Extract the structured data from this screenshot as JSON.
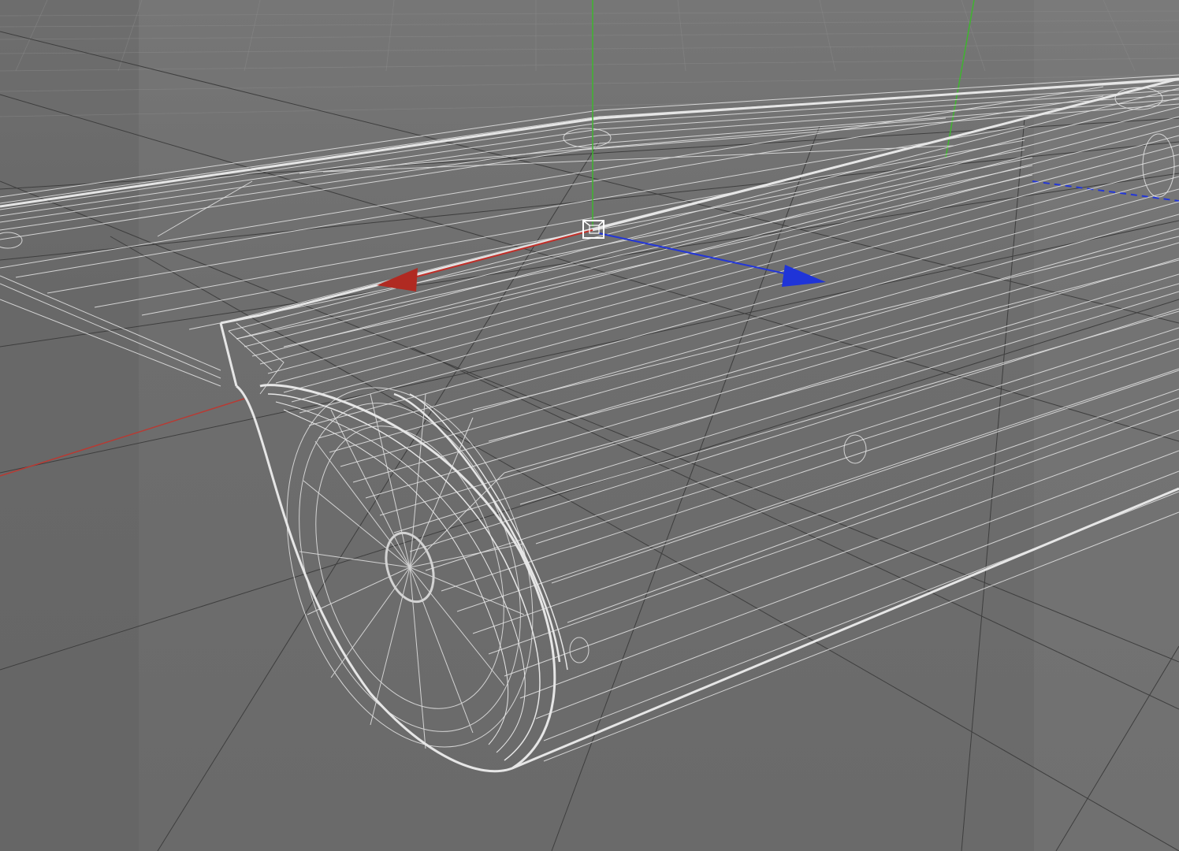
{
  "viewport": {
    "mode": "wireframe",
    "object": "hull-mesh",
    "colors": {
      "background": "#6b6b6b",
      "safe_frame_overlay": "#7a7a7a",
      "grid": "#3e3e3e",
      "wireframe": "#e6e6e6",
      "axis_x": "#c0302a",
      "axis_y": "#3fb52f",
      "axis_z": "#2437d6"
    },
    "gizmo": {
      "type": "move",
      "axes": [
        "x",
        "y",
        "z"
      ]
    }
  }
}
